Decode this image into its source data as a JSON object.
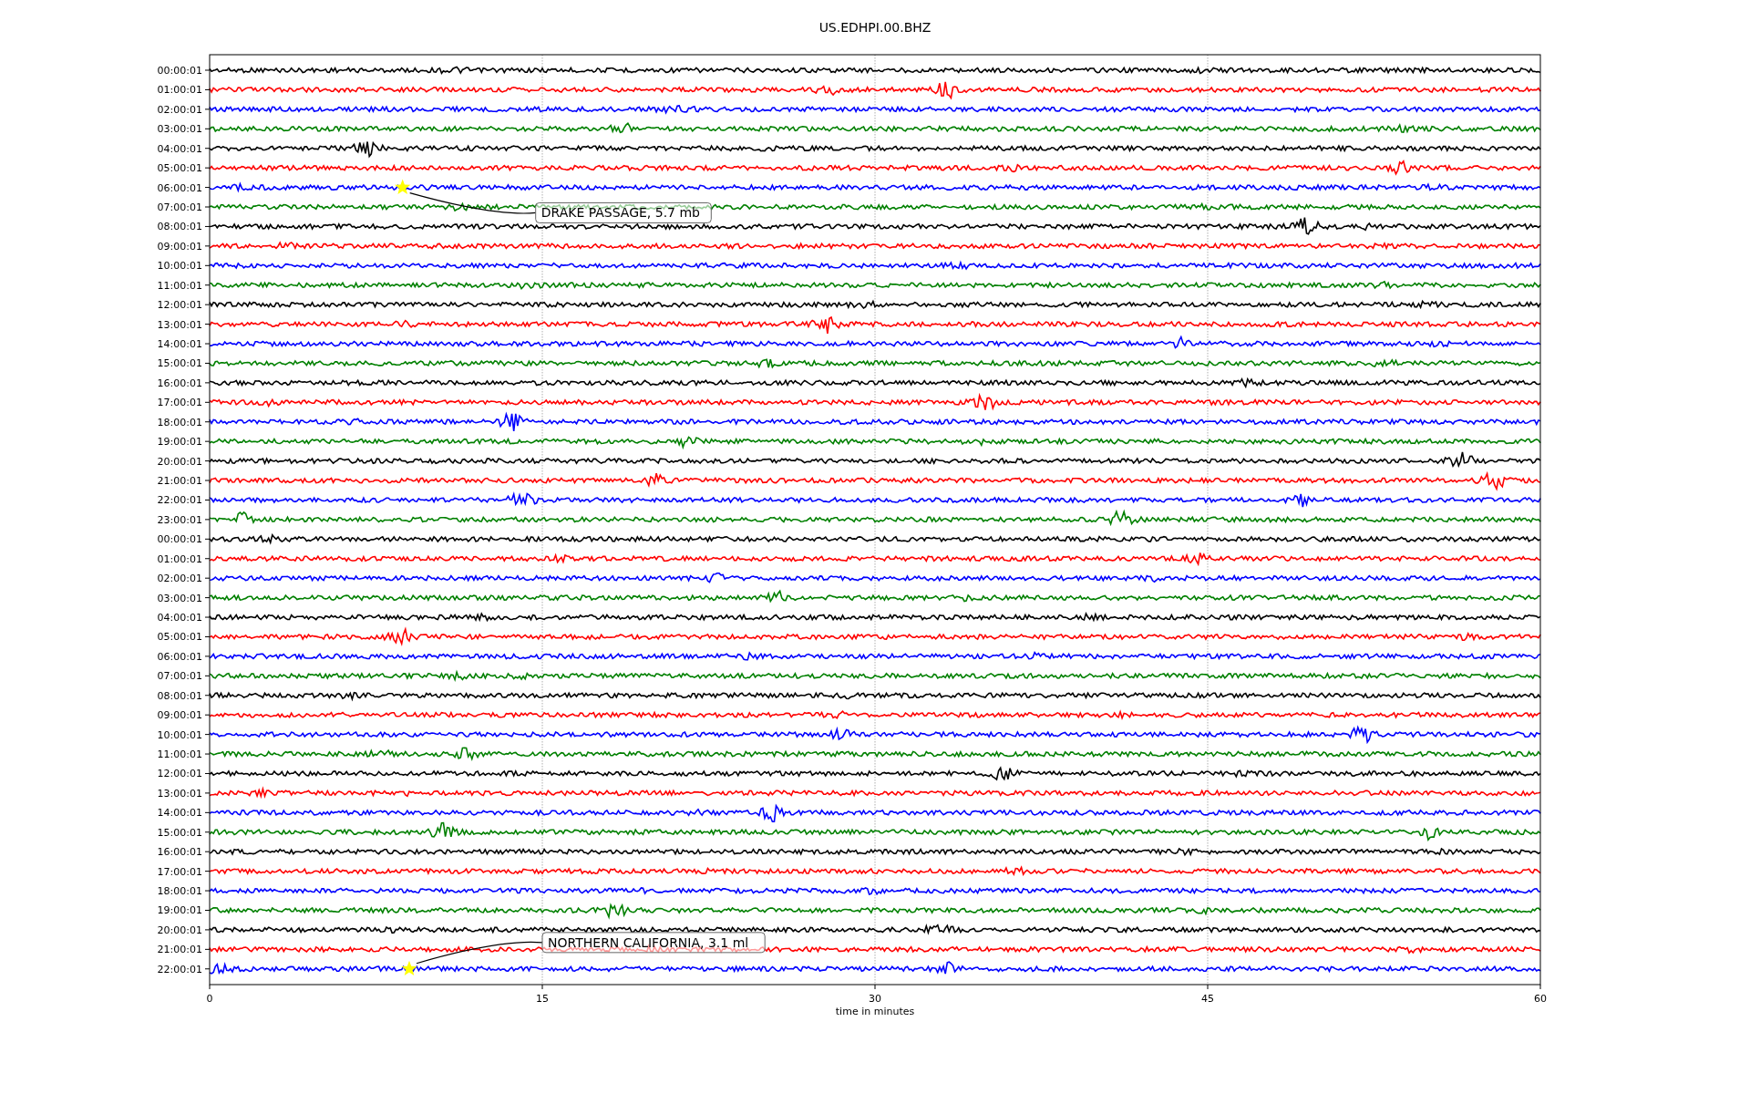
{
  "title": "US.EDHPI.00.BHZ",
  "xlabel": "time in minutes",
  "xticks": [
    "0",
    "15",
    "30",
    "45",
    "60"
  ],
  "rows": [
    {
      "label": "00:00:01",
      "color": "#000000"
    },
    {
      "label": "01:00:01",
      "color": "#ff0000"
    },
    {
      "label": "02:00:01",
      "color": "#0000ff"
    },
    {
      "label": "03:00:01",
      "color": "#008000"
    },
    {
      "label": "04:00:01",
      "color": "#000000"
    },
    {
      "label": "05:00:01",
      "color": "#ff0000"
    },
    {
      "label": "06:00:01",
      "color": "#0000ff"
    },
    {
      "label": "07:00:01",
      "color": "#008000"
    },
    {
      "label": "08:00:01",
      "color": "#000000"
    },
    {
      "label": "09:00:01",
      "color": "#ff0000"
    },
    {
      "label": "10:00:01",
      "color": "#0000ff"
    },
    {
      "label": "11:00:01",
      "color": "#008000"
    },
    {
      "label": "12:00:01",
      "color": "#000000"
    },
    {
      "label": "13:00:01",
      "color": "#ff0000"
    },
    {
      "label": "14:00:01",
      "color": "#0000ff"
    },
    {
      "label": "15:00:01",
      "color": "#008000"
    },
    {
      "label": "16:00:01",
      "color": "#000000"
    },
    {
      "label": "17:00:01",
      "color": "#ff0000"
    },
    {
      "label": "18:00:01",
      "color": "#0000ff"
    },
    {
      "label": "19:00:01",
      "color": "#008000"
    },
    {
      "label": "20:00:01",
      "color": "#000000"
    },
    {
      "label": "21:00:01",
      "color": "#ff0000"
    },
    {
      "label": "22:00:01",
      "color": "#0000ff"
    },
    {
      "label": "23:00:01",
      "color": "#008000"
    },
    {
      "label": "00:00:01",
      "color": "#000000"
    },
    {
      "label": "01:00:01",
      "color": "#ff0000"
    },
    {
      "label": "02:00:01",
      "color": "#0000ff"
    },
    {
      "label": "03:00:01",
      "color": "#008000"
    },
    {
      "label": "04:00:01",
      "color": "#000000"
    },
    {
      "label": "05:00:01",
      "color": "#ff0000"
    },
    {
      "label": "06:00:01",
      "color": "#0000ff"
    },
    {
      "label": "07:00:01",
      "color": "#008000"
    },
    {
      "label": "08:00:01",
      "color": "#000000"
    },
    {
      "label": "09:00:01",
      "color": "#ff0000"
    },
    {
      "label": "10:00:01",
      "color": "#0000ff"
    },
    {
      "label": "11:00:01",
      "color": "#008000"
    },
    {
      "label": "12:00:01",
      "color": "#000000"
    },
    {
      "label": "13:00:01",
      "color": "#ff0000"
    },
    {
      "label": "14:00:01",
      "color": "#0000ff"
    },
    {
      "label": "15:00:01",
      "color": "#008000"
    },
    {
      "label": "16:00:01",
      "color": "#000000"
    },
    {
      "label": "17:00:01",
      "color": "#ff0000"
    },
    {
      "label": "18:00:01",
      "color": "#0000ff"
    },
    {
      "label": "19:00:01",
      "color": "#008000"
    },
    {
      "label": "20:00:01",
      "color": "#000000"
    },
    {
      "label": "21:00:01",
      "color": "#ff0000"
    },
    {
      "label": "22:00:01",
      "color": "#0000ff"
    }
  ],
  "events": [
    {
      "label": "DRAKE PASSAGE, 5.7 mb"
    },
    {
      "label": "NORTHERN CALIFORNIA, 3.1 ml"
    }
  ]
}
